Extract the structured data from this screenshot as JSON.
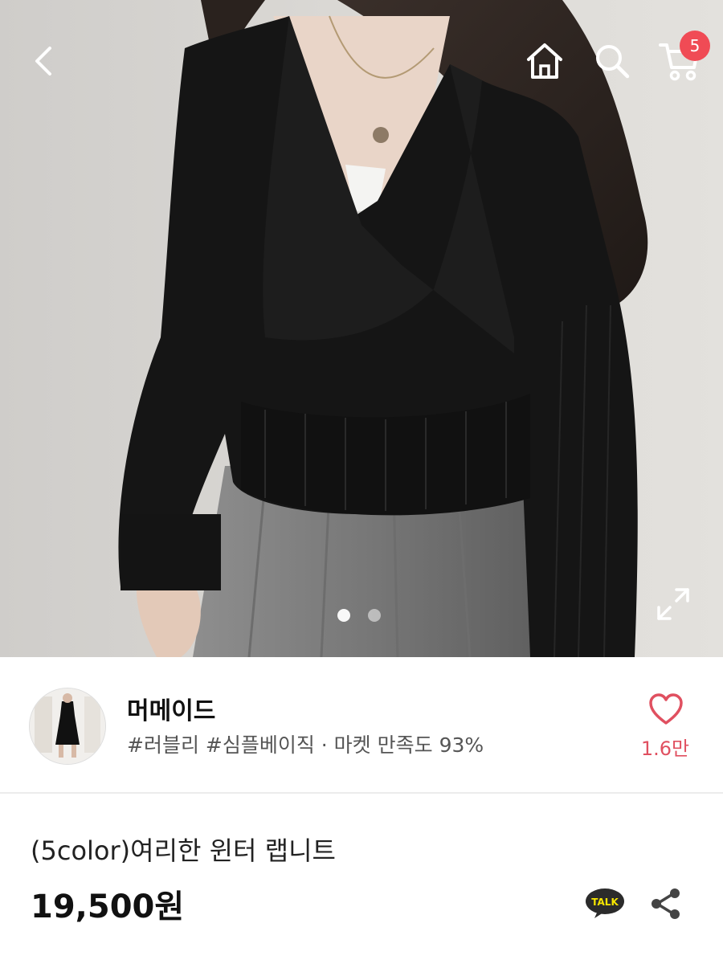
{
  "header": {
    "back_icon": "chevron-left-icon",
    "home_icon": "home-icon",
    "search_icon": "search-icon",
    "cart_icon": "cart-icon",
    "cart_count": "5"
  },
  "gallery": {
    "current_index": 1,
    "total": 2,
    "expand_icon": "expand-icon"
  },
  "shop": {
    "name": "머메이드",
    "tags": "#러블리 #심플베이직 · 마켓 만족도 93%",
    "favorite_count": "1.6만",
    "favorite_icon": "heart-outline-icon"
  },
  "product": {
    "name": "(5color)여리한 윈터 랩니트",
    "price": "19,500원"
  },
  "actions": {
    "talk_label": "TALK",
    "share_icon": "share-icon"
  },
  "colors": {
    "badge": "#f04b55",
    "heart": "#e05060",
    "talk_bubble": "#2b2b2b",
    "talk_text": "#f7e600"
  }
}
